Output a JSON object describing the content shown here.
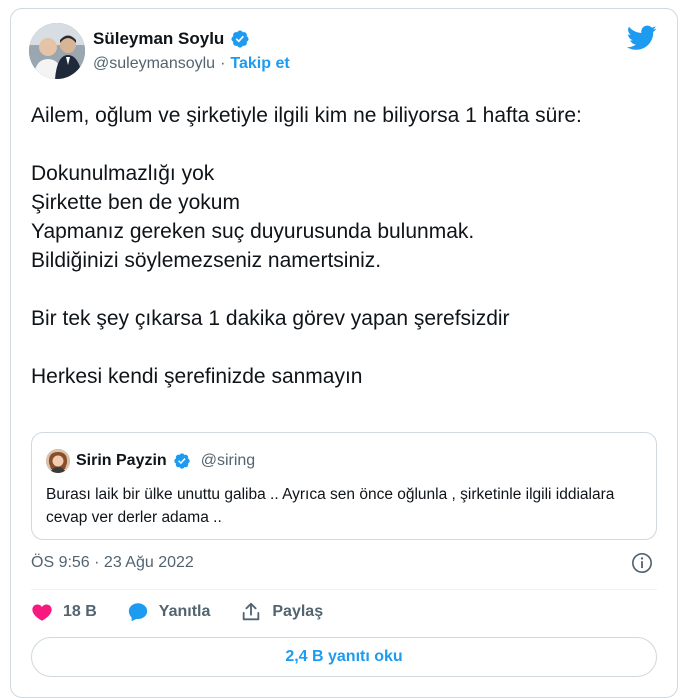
{
  "author": {
    "display_name": "Süleyman Soylu",
    "handle": "@suleymansoylu",
    "separator": "·",
    "follow_label": "Takip et",
    "avatar_icon": "profile-photo"
  },
  "tweet": {
    "text": "Ailem, oğlum ve şirketiyle ilgili kim ne biliyorsa 1 hafta süre:\n\nDokunulmazlığı yok\nŞirkette ben de yokum\nYapmanız gereken suç duyurusunda bulunmak.\nBildiğinizi söylemezseniz namertsiniz.\n\nBir tek şey çıkarsa 1 dakika görev yapan şerefsizdir\n\nHerkesi kendi şerefinizde sanmayın"
  },
  "quoted": {
    "display_name": "Sirin Payzin",
    "handle": "@siring",
    "text": "Burası laik bir ülke unuttu galiba .. Ayrıca sen önce oğlunla , şirketinle ilgili iddialara cevap ver derler adama .."
  },
  "meta": {
    "timestamp": "ÖS 9:56 · 23 Ağu 2022"
  },
  "actions": {
    "like_count": "18 B",
    "reply_label": "Yanıtla",
    "share_label": "Paylaş"
  },
  "read_replies_label": "2,4 B yanıtı oku",
  "colors": {
    "accent": "#1d9bf0",
    "like": "#f91880",
    "text": "#0f1419",
    "muted": "#536471",
    "border": "#cfd9de"
  }
}
